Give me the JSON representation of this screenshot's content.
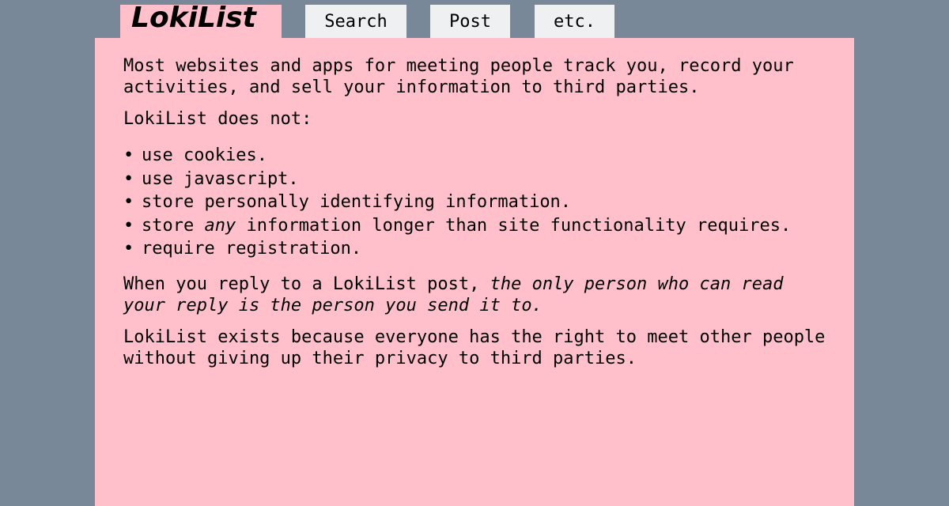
{
  "nav": {
    "logo": "LokiList",
    "tabs": {
      "search": "Search",
      "post": "Post",
      "etc": "etc."
    }
  },
  "content": {
    "intro": "Most websites and apps for meeting people track you, record your activities, and sell your information to third parties.",
    "does_not_heading": "LokiList does not:",
    "bullet_char": "•",
    "features": {
      "cookies": "use cookies.",
      "javascript": "use javascript.",
      "pii": "store personally identifying information.",
      "retention_before": "store ",
      "retention_emphasis": "any",
      "retention_after": " information longer than site functionality requires.",
      "registration": "require registration."
    },
    "reply_before": "When you reply to a LokiList post, ",
    "reply_emphasis": "the only person who can read your reply is the person you send it to.",
    "closing": "LokiList exists because everyone has the right to meet other people without giving up their privacy to third parties."
  },
  "colors": {
    "background": "#788899",
    "content_background": "#ffc0cb",
    "tab_background": "#eef0f1",
    "text": "#000000"
  }
}
